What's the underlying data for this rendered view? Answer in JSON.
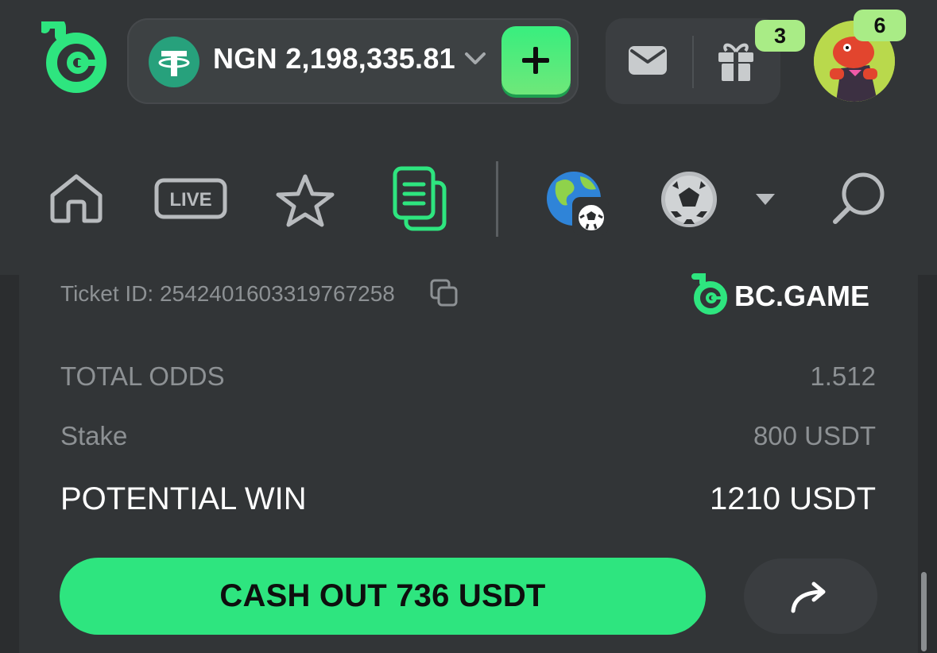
{
  "header": {
    "logo_icon": "bc-game-logo-icon",
    "wallet": {
      "currency_icon": "tether-icon",
      "balance": "NGN 2,198,335.81",
      "dropdown_icon": "chevron-down-icon",
      "add_icon": "plus-icon"
    },
    "mail_icon": "mail-icon",
    "gift_icon": "gift-icon",
    "gift_badge": "3",
    "avatar_badge": "6"
  },
  "nav": {
    "items": [
      "home-icon",
      "live-icon",
      "favorites-star-icon",
      "bet-slip-icon",
      "sport-globe-icon",
      "soccer-ball-icon",
      "dropdown-caret-icon",
      "search-icon"
    ],
    "live_label": "LIVE"
  },
  "ticket": {
    "id_text": "Ticket ID: 2542401603319767258",
    "brand": "BC.GAME",
    "rows": [
      {
        "label": "TOTAL ODDS",
        "value": "1.512"
      },
      {
        "label": "Stake",
        "value": "800 USDT"
      },
      {
        "label": "POTENTIAL WIN",
        "value": "1210 USDT"
      }
    ],
    "cashout_label": "CASH OUT 736 USDT"
  },
  "colors": {
    "accent_green": "#2ee57f",
    "badge_green": "#a9ec86",
    "background": "#2b2d2f",
    "panel": "#323537"
  }
}
